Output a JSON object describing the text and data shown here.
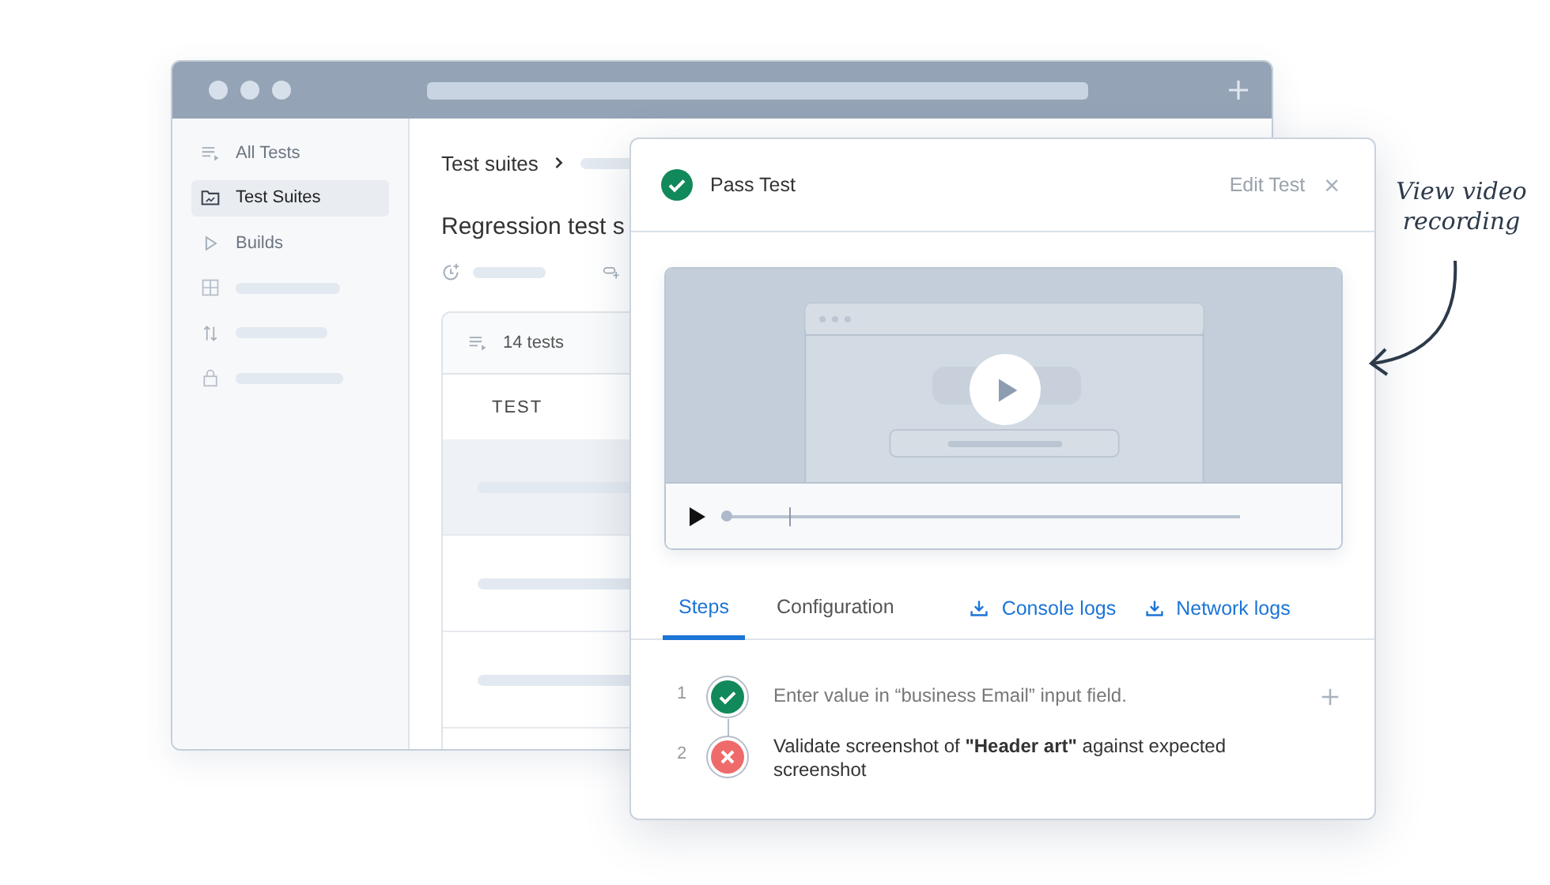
{
  "sidebar": {
    "items": [
      {
        "label": "All Tests",
        "selected": false
      },
      {
        "label": "Test Suites",
        "selected": true
      },
      {
        "label": "Builds",
        "selected": false
      }
    ]
  },
  "main": {
    "breadcrumb": "Test suites",
    "title": "Regression test s",
    "table": {
      "count": "14 tests",
      "columns": [
        "TEST"
      ],
      "rows": [
        {
          "selected": true
        },
        {
          "selected": false
        },
        {
          "selected": false
        }
      ]
    }
  },
  "dialog": {
    "title": "Pass Test",
    "edit": "Edit Test",
    "close": "×",
    "player": {
      "level": 0.13
    },
    "tabs": [
      {
        "label": "Steps",
        "selected": true
      },
      {
        "label": "Configuration",
        "selected": false
      }
    ],
    "links": [
      "Console logs",
      "Network logs"
    ],
    "steps": [
      {
        "number": "1",
        "kind": "pass",
        "text": "Enter value in “business Email” input field."
      },
      {
        "number": "2",
        "kind": "fail",
        "text": "Validate screenshot of **\"Header art\"** against expected screenshot"
      }
    ]
  },
  "annotation": "View video recording"
}
